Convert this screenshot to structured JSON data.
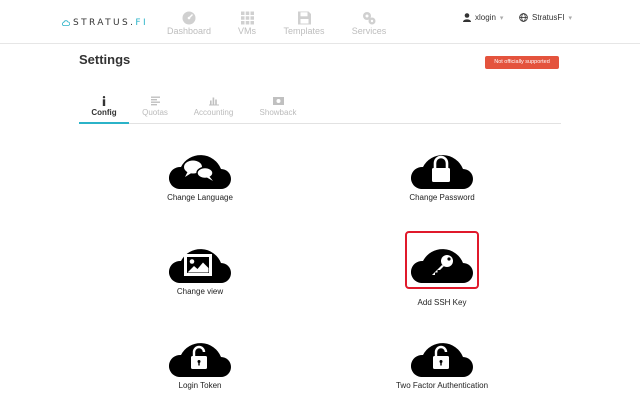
{
  "brand": {
    "name": "STRATUS.",
    "suffix": "FI"
  },
  "nav": {
    "items": [
      {
        "label": "Dashboard",
        "icon": "dashboard-icon"
      },
      {
        "label": "VMs",
        "icon": "grid-icon"
      },
      {
        "label": "Templates",
        "icon": "floppy-icon"
      },
      {
        "label": "Services",
        "icon": "services-icon"
      }
    ],
    "user": {
      "label": "xlogin",
      "icon": "user-icon"
    },
    "org": {
      "label": "StratusFI",
      "icon": "globe-icon"
    }
  },
  "page": {
    "title": "Settings",
    "badge": "Not officially supported"
  },
  "tabs": [
    {
      "label": "Config",
      "icon": "info-icon",
      "active": true
    },
    {
      "label": "Quotas",
      "icon": "list-icon",
      "active": false
    },
    {
      "label": "Accounting",
      "icon": "bar-chart-icon",
      "active": false
    },
    {
      "label": "Showback",
      "icon": "money-icon",
      "active": false
    }
  ],
  "tiles": [
    {
      "label": "Change Language",
      "icon": "speech-bubbles-icon"
    },
    {
      "label": "Change Password",
      "icon": "lock-icon"
    },
    {
      "label": "Change view",
      "icon": "image-icon"
    },
    {
      "label": "Add SSH Key",
      "icon": "key-icon",
      "selected": true
    },
    {
      "label": "Login Token",
      "icon": "unlock-icon"
    },
    {
      "label": "Two Factor Authentication",
      "icon": "unlock-icon"
    }
  ],
  "colors": {
    "accent": "#2bb3c8",
    "badge": "#e4533d",
    "selection": "#e0192b",
    "nav_inactive": "#c7c7c7"
  }
}
